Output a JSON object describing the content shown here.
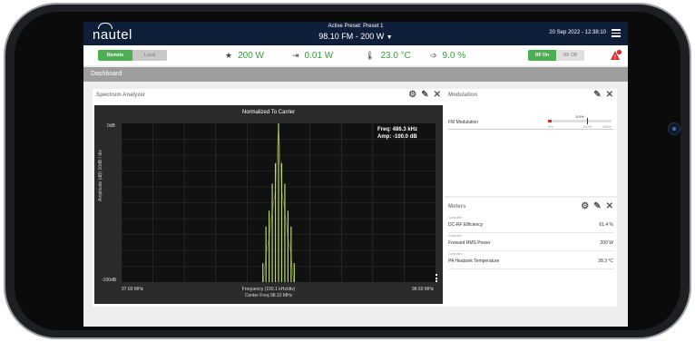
{
  "header": {
    "logo": "nautel",
    "active_preset_label": "Active Preset: Preset 1",
    "preset_value": "98.10 FM - 200 W",
    "datetime": "20 Sep 2022 - 12:38:10"
  },
  "status": {
    "remote_label": "Remote",
    "local_label": "Local",
    "power": "200 W",
    "reflected": "0.01 W",
    "temperature": "23.0 °C",
    "efficiency": "9.0 %",
    "rf_on_label": "RF On",
    "rf_off_label": "RF Off"
  },
  "dashboard": {
    "title": "Dashboard"
  },
  "spectrum": {
    "panel_title": "Spectrum Analyzer",
    "chart_title": "Normalized To Carrier",
    "y_top": "0dB",
    "y_bottom": "-100dB",
    "y_axis_label": "Amplitude (dB) 10dB / div",
    "x_left": "97.60 MHz",
    "x_right": "98.60 MHz",
    "x_center_label": "Frequency (100.1 kHz/div)",
    "x_center_freq": "Center Freq 98.10 MHz",
    "freq_readout": "Freq: 486.3 kHz",
    "amp_readout": "Amp: -100.0 dB"
  },
  "modulation": {
    "panel_title": "Modulation",
    "row_label": "FM Modulation",
    "value_label": "5.0%",
    "value_fraction": 0.05,
    "tick_0": "0%",
    "tick_100": "100%",
    "tick_160": "160%"
  },
  "meters": {
    "panel_title": "Meters",
    "rows": [
      {
        "category": "Controller",
        "name": "DC-RF Efficiency",
        "value": "61.4 %"
      },
      {
        "category": "Controller",
        "name": "Forward RMS Power",
        "value": "200 W"
      },
      {
        "category": "Controller",
        "name": "PA Heatsink Temperature",
        "value": "28.3 °C"
      }
    ]
  },
  "chart_data": {
    "type": "line",
    "title": "Normalized To Carrier",
    "xlabel": "Frequency (100.1 kHz/div)",
    "ylabel": "Amplitude (dB) 10dB / div",
    "x_range": [
      97.6,
      98.6
    ],
    "ylim": [
      -100,
      0
    ],
    "grid": true,
    "series": [
      {
        "x": [
          98.05,
          98.06,
          98.07,
          98.08,
          98.09,
          98.1,
          98.11,
          98.12,
          98.13,
          98.14,
          98.15
        ],
        "values": [
          -88,
          -65,
          -55,
          -38,
          -25,
          0,
          -25,
          -38,
          -55,
          -65,
          -88
        ]
      }
    ],
    "colors": {
      "trace": "#b8d96a",
      "background": "#111111",
      "grid": "#333333"
    }
  }
}
